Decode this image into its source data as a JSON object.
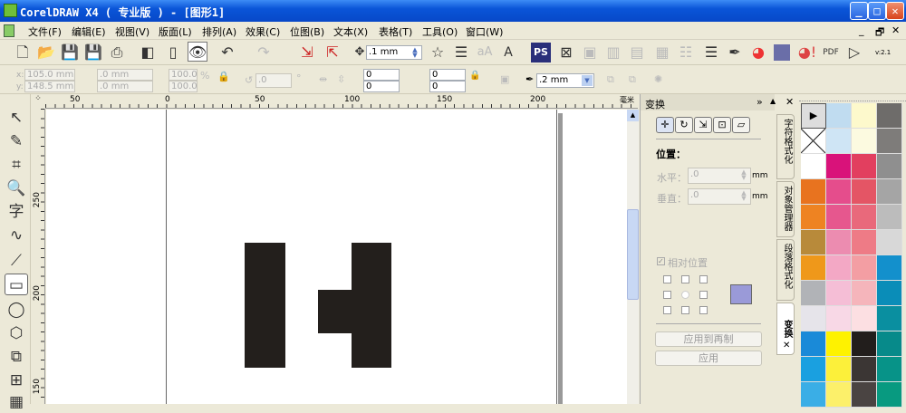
{
  "window": {
    "title": "CorelDRAW X4 ( 专业版 ) - [图形1]",
    "min": "_",
    "max": "□",
    "close": "✕"
  },
  "menu": [
    "文件(F)",
    "编辑(E)",
    "视图(V)",
    "版面(L)",
    "排列(A)",
    "效果(C)",
    "位图(B)",
    "文本(X)",
    "表格(T)",
    "工具(O)",
    "窗口(W)"
  ],
  "doc_controls": {
    "min": "_",
    "restore": "🗗",
    "close": "✕"
  },
  "toolbar": {
    "nudge": ".1 mm",
    "version": "v:2.1"
  },
  "propbar": {
    "x_label": "x:",
    "x": "105.0 mm",
    "y_label": "y:",
    "y": "148.5 mm",
    "w": ".0 mm",
    "h": ".0 mm",
    "sx": "100.0",
    "sy": "100.0",
    "pct": "%",
    "angle": ".0",
    "deg": "°",
    "c1": "0",
    "c2": "0",
    "c3": "0",
    "c4": "0",
    "outline": ".2 mm"
  },
  "ruler": {
    "h": [
      "50",
      "0",
      "50",
      "100",
      "150",
      "200"
    ],
    "unit": "毫米",
    "v": [
      "250",
      "200",
      "150"
    ]
  },
  "docker": {
    "title": "变换",
    "more": "»",
    "up": "▲",
    "close": "✕",
    "section": "位置：",
    "h_label": "水平：",
    "h_value": ".0",
    "v_label": "垂直：",
    "v_value": ".0",
    "unit": "mm",
    "relative": "相对位置",
    "apply_dup": "应用到再制",
    "apply": "应用",
    "tabs": [
      "字符格式化",
      "对象管理器",
      "段落格式化",
      "变换"
    ],
    "tab_close": "✕"
  },
  "palette": [
    [
      "#c0dcf0",
      "#fdf9cc",
      "#6e6c6a"
    ],
    [
      "#cfe5f5",
      "#fcfae0",
      "#7e7c7a"
    ],
    [
      "#ffffff",
      "#d9127a",
      "#e23f5f",
      "#8f8f8f"
    ],
    [
      "#e8731f",
      "#e54d8c",
      "#e45565",
      "#a5a5a5"
    ],
    [
      "#ee8322",
      "#e6578e",
      "#e9697b",
      "#bcbcbc"
    ],
    [
      "#b88a3a",
      "#ec8cb0",
      "#ee7b86",
      "#d8d8d8"
    ],
    [
      "#ef981a",
      "#f3a8c5",
      "#f39ea3",
      "#1390cc"
    ],
    [
      "#b1b3b7",
      "#f5bed6",
      "#f5b5bb",
      "#0a8db8"
    ],
    [
      "#e6e4ea",
      "#f8d8e6",
      "#fcdfe2",
      "#0a8fa0"
    ],
    [
      "#1a8ad8",
      "#fef200",
      "#221e1c",
      "#078a8a"
    ],
    [
      "#1aa0e0",
      "#fcf03a",
      "#3b3634",
      "#079388"
    ],
    [
      "#3aaee6",
      "#fcf06a",
      "#4a4442",
      "#089a80"
    ]
  ],
  "shape_color": "#231f1c"
}
